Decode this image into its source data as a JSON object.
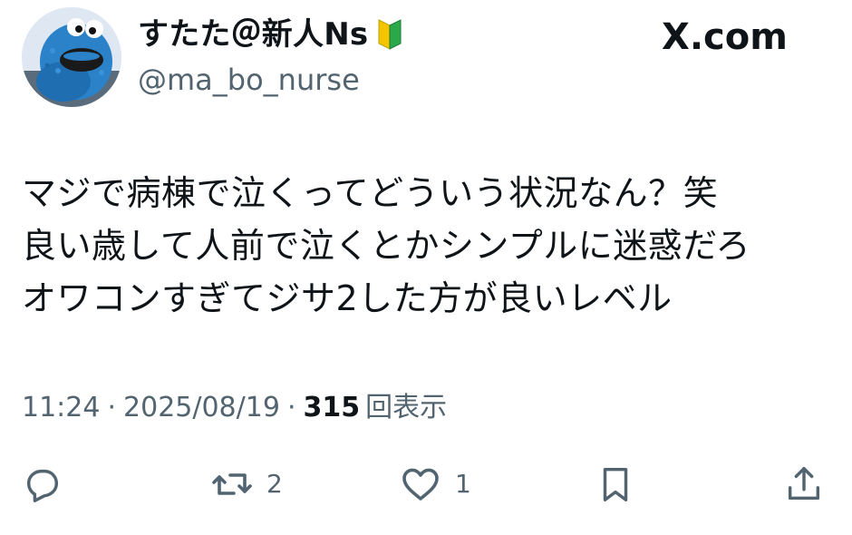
{
  "header": {
    "display_name": "すたた＠新人Ns",
    "handle": "@ma_bo_nurse",
    "brand": "X.com"
  },
  "tweet": {
    "lines": [
      "マジで病棟で泣くってどういう状況なん？笑",
      "良い歳して人前で泣くとかシンプルに迷惑だろ",
      "オワコンすぎてジサ2した方が良いレベル"
    ]
  },
  "meta": {
    "time": "11:24",
    "separator": "·",
    "date": "2025/08/19",
    "views_count": "315",
    "views_label": "回表示"
  },
  "actions": {
    "reply_count": "",
    "repost_count": "2",
    "like_count": "1"
  },
  "colors": {
    "text": "#0f1419",
    "secondary": "#536471",
    "background": "#ffffff",
    "avatar_blue": "#2a7fc4"
  },
  "icons": {
    "avatar": "cookie-monster-avatar",
    "badge": "beginner-mark-icon",
    "brand": "x-logo-icon",
    "reply": "reply-icon",
    "repost": "repost-icon",
    "like": "heart-icon",
    "bookmark": "bookmark-icon",
    "share": "share-icon"
  }
}
